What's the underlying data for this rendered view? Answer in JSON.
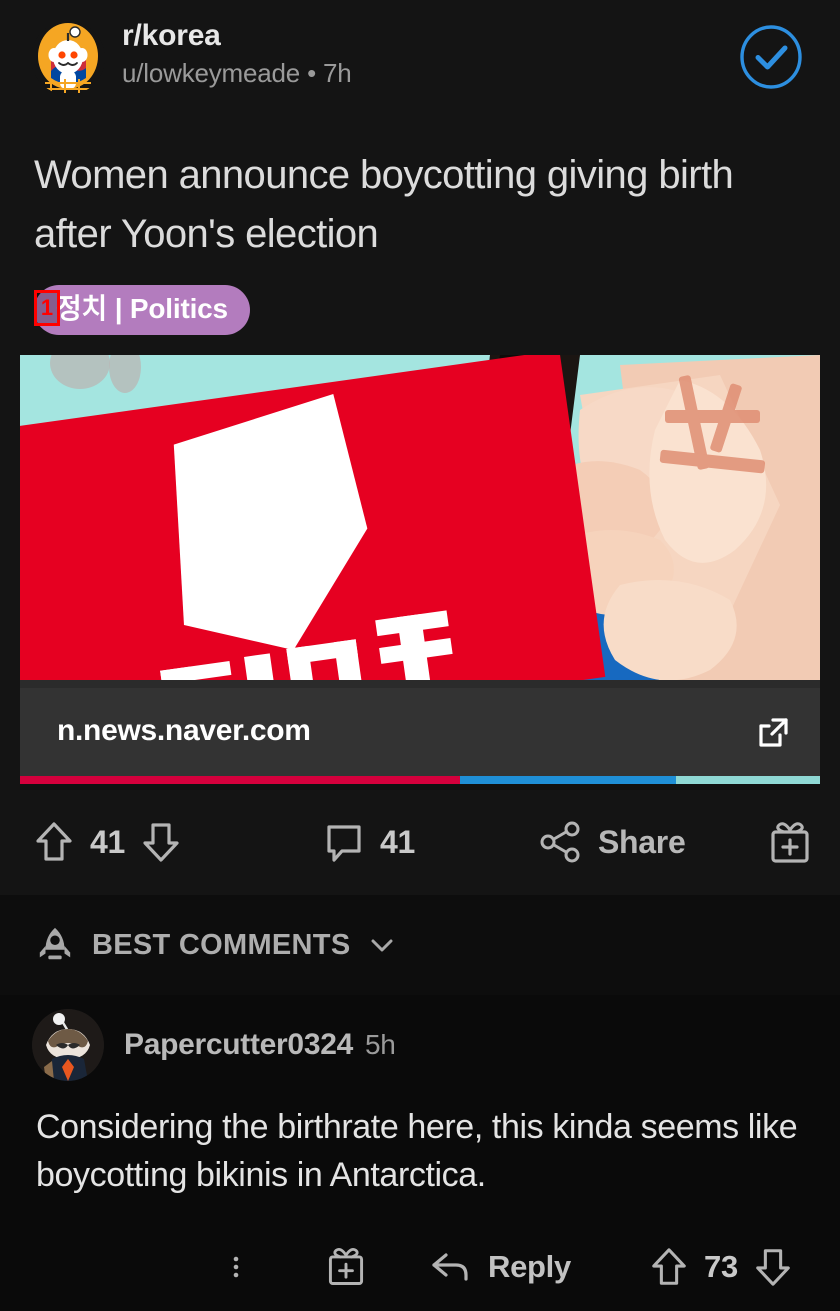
{
  "post": {
    "subreddit": "r/korea",
    "author_meta": "u/lowkeymeade • 7h",
    "joined_icon": "check-circle-icon",
    "avatar_icon": "subreddit-avatar-snoo-korea",
    "title": "Women announce boycotting giving birth after Yoon's election",
    "flair": {
      "label": "정치 | Politics",
      "background": "#b37cbe",
      "text_color": "#ffffff"
    },
    "annotation": {
      "marker": "1",
      "color": "#ff0000"
    },
    "media": {
      "alt_description": "Protest photo: red sign with white Korean lettering, hand giving thumbs down, teal background",
      "link_domain": "n.news.naver.com",
      "external_icon": "external-link-icon"
    },
    "actions": {
      "upvote_icon": "upvote-arrow-icon",
      "downvote_icon": "downvote-arrow-icon",
      "score": "41",
      "comment_icon": "comment-bubble-icon",
      "comment_count": "41",
      "share_icon": "share-icon",
      "share_label": "Share",
      "award_icon": "award-gift-icon"
    }
  },
  "comments_section": {
    "sort_icon": "rocket-icon",
    "sort_label": "BEST COMMENTS",
    "chevron_icon": "chevron-down-icon"
  },
  "comment": {
    "avatar_icon": "user-avatar-snoo",
    "author": "Papercutter0324",
    "time": "5h",
    "body": "Considering the birthrate here, this kinda seems like boycotting bikinis in Antarctica.",
    "actions": {
      "more_icon": "overflow-dots-icon",
      "award_icon": "award-gift-icon",
      "reply_icon": "reply-arrow-icon",
      "reply_label": "Reply",
      "upvote_icon": "upvote-arrow-icon",
      "score": "73",
      "downvote_icon": "downvote-arrow-icon"
    }
  },
  "theme": {
    "background": "#0b0b0b",
    "card_background": "#141414",
    "text_primary": "#e4e4e4",
    "text_secondary": "#9a9a9a",
    "accent_blue": "#2d8fe0",
    "flair_purple": "#b37cbe",
    "annotation_red": "#ff0000"
  }
}
